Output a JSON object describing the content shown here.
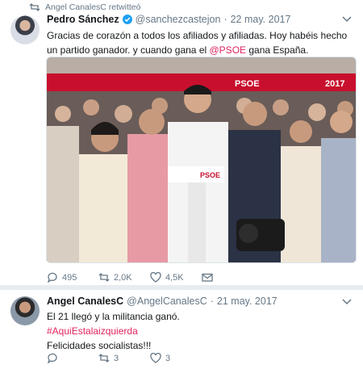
{
  "retweet_notice": {
    "text": "Angel CanalesC retwitteó"
  },
  "tweet1": {
    "name": "Pedro Sánchez",
    "handle": "@sanchezcastejon",
    "separator": "·",
    "date": "22 may. 2017",
    "text_before": "Gracias de corazón a todos los afiliados y afiliadas. Hoy habéis hecho un partido ganador. y cuando gana el ",
    "mention": "@PSOE",
    "text_after": " gana España.",
    "media_banner": "PSOE",
    "media_lectern": "PSOE",
    "media_corner": "2017",
    "replies": "495",
    "retweets": "2,0K",
    "likes": "4,5K"
  },
  "tweet2": {
    "name": "Angel CanalesC",
    "handle": "@AngelCanalesC",
    "separator": "·",
    "date": "21 may. 2017",
    "line1": "El 21 llegó y la militancia ganó.",
    "hashtag": "#AquiEstalaizquierda",
    "line3": "Felicidades socialistas!!!",
    "replies": "",
    "retweets": "3",
    "likes": "3"
  },
  "colors": {
    "accent": "#e0245e",
    "muted": "#657786",
    "verified": "#1da1f2",
    "divider": "#e6ecf0"
  },
  "icons": [
    "retweet-icon",
    "verified-icon",
    "chevron-down-icon",
    "reply-icon",
    "heart-icon",
    "mail-icon"
  ]
}
